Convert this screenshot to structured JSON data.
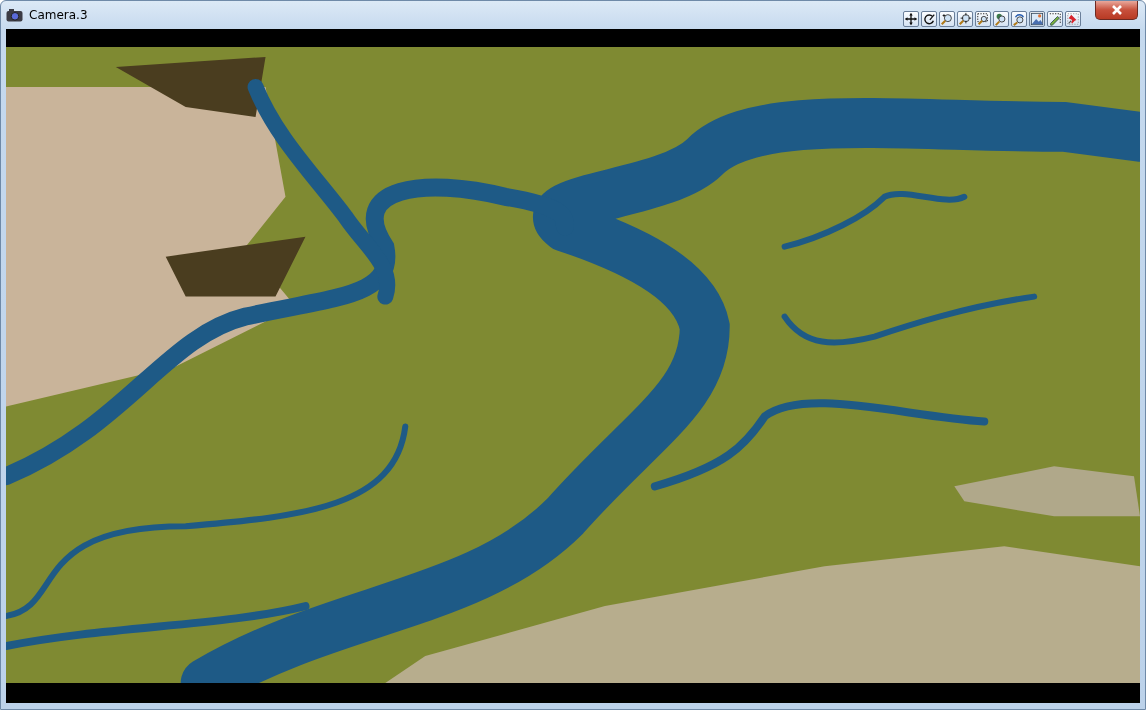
{
  "window": {
    "title": "Camera.3"
  }
}
